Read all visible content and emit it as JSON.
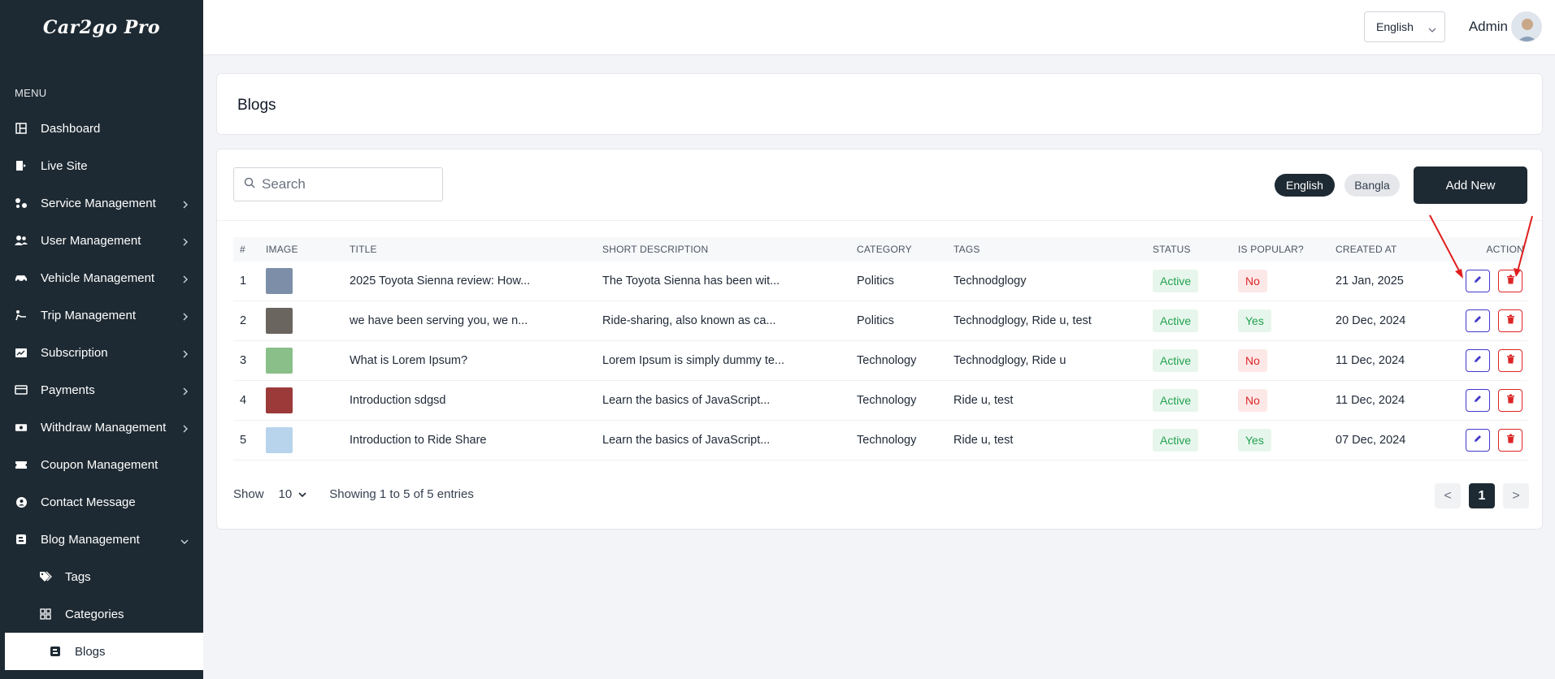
{
  "app": {
    "logo": "Car2go Pro"
  },
  "sidebar": {
    "menu_heading": "MENU",
    "items": [
      {
        "label": "Dashboard",
        "icon": "dashboard-icon",
        "has_children": false
      },
      {
        "label": "Live Site",
        "icon": "live-site-icon",
        "has_children": false
      },
      {
        "label": "Service Management",
        "icon": "service-icon",
        "has_children": true
      },
      {
        "label": "User Management",
        "icon": "users-icon",
        "has_children": true
      },
      {
        "label": "Vehicle Management",
        "icon": "car-icon",
        "has_children": true
      },
      {
        "label": "Trip Management",
        "icon": "trip-icon",
        "has_children": true
      },
      {
        "label": "Subscription",
        "icon": "subscription-icon",
        "has_children": true
      },
      {
        "label": "Payments",
        "icon": "card-icon",
        "has_children": true
      },
      {
        "label": "Withdraw Management",
        "icon": "withdraw-icon",
        "has_children": true
      },
      {
        "label": "Coupon Management",
        "icon": "coupon-icon",
        "has_children": false
      },
      {
        "label": "Contact Message",
        "icon": "contact-icon",
        "has_children": false
      },
      {
        "label": "Blog Management",
        "icon": "blog-icon",
        "has_children": true,
        "expanded": true
      }
    ],
    "subitems": [
      {
        "label": "Tags",
        "icon": "tags-icon"
      },
      {
        "label": "Categories",
        "icon": "categories-icon"
      },
      {
        "label": "Blogs",
        "icon": "blog-icon",
        "active": true
      }
    ]
  },
  "header": {
    "language_selected": "English",
    "user_name": "Admin"
  },
  "page": {
    "title": "Blogs"
  },
  "toolbar": {
    "search_placeholder": "Search",
    "languages": [
      "English",
      "Bangla"
    ],
    "active_language": "English",
    "add_label": "Add New"
  },
  "table": {
    "columns": [
      "#",
      "IMAGE",
      "TITLE",
      "SHORT DESCRIPTION",
      "CATEGORY",
      "TAGS",
      "STATUS",
      "IS POPULAR?",
      "CREATED AT",
      "ACTION"
    ],
    "rows": [
      {
        "num": "1",
        "title": "2025 Toyota Sienna review: How...",
        "desc": "The Toyota Sienna has been wit...",
        "category": "Politics",
        "tags": "Technodglogy",
        "status": "Active",
        "popular": "No",
        "created": "21 Jan, 2025",
        "thumb_color": "#7d8fa8"
      },
      {
        "num": "2",
        "title": "we have been serving you, we n...",
        "desc": "Ride-sharing, also known as ca...",
        "category": "Politics",
        "tags": "Technodglogy, Ride u, test",
        "status": "Active",
        "popular": "Yes",
        "created": "20 Dec, 2024",
        "thumb_color": "#6b6560"
      },
      {
        "num": "3",
        "title": "What is Lorem Ipsum?",
        "desc": "Lorem Ipsum is simply dummy te...",
        "category": "Technology",
        "tags": "Technodglogy, Ride u",
        "status": "Active",
        "popular": "No",
        "created": "11 Dec, 2024",
        "thumb_color": "#8bbf8a"
      },
      {
        "num": "4",
        "title": "Introduction sdgsd",
        "desc": "Learn the basics of JavaScript...",
        "category": "Technology",
        "tags": "Ride u, test",
        "status": "Active",
        "popular": "No",
        "created": "11 Dec, 2024",
        "thumb_color": "#9c3a3a"
      },
      {
        "num": "5",
        "title": "Introduction to Ride Share",
        "desc": "Learn the basics of JavaScript...",
        "category": "Technology",
        "tags": "Ride u, test",
        "status": "Active",
        "popular": "Yes",
        "created": "07 Dec, 2024",
        "thumb_color": "#b8d4ec"
      }
    ]
  },
  "pagination": {
    "show_label": "Show",
    "page_size": "10",
    "summary": "Showing 1 to 5 of 5 entries",
    "prev": "<",
    "current": "1",
    "next": ">"
  },
  "colors": {
    "sidebar_bg": "#1e2a33",
    "accent_dark": "#1e2a33",
    "success": "#22a150",
    "danger": "#dc2626",
    "edit": "#4338ca",
    "annotation": "#e11d1d"
  }
}
